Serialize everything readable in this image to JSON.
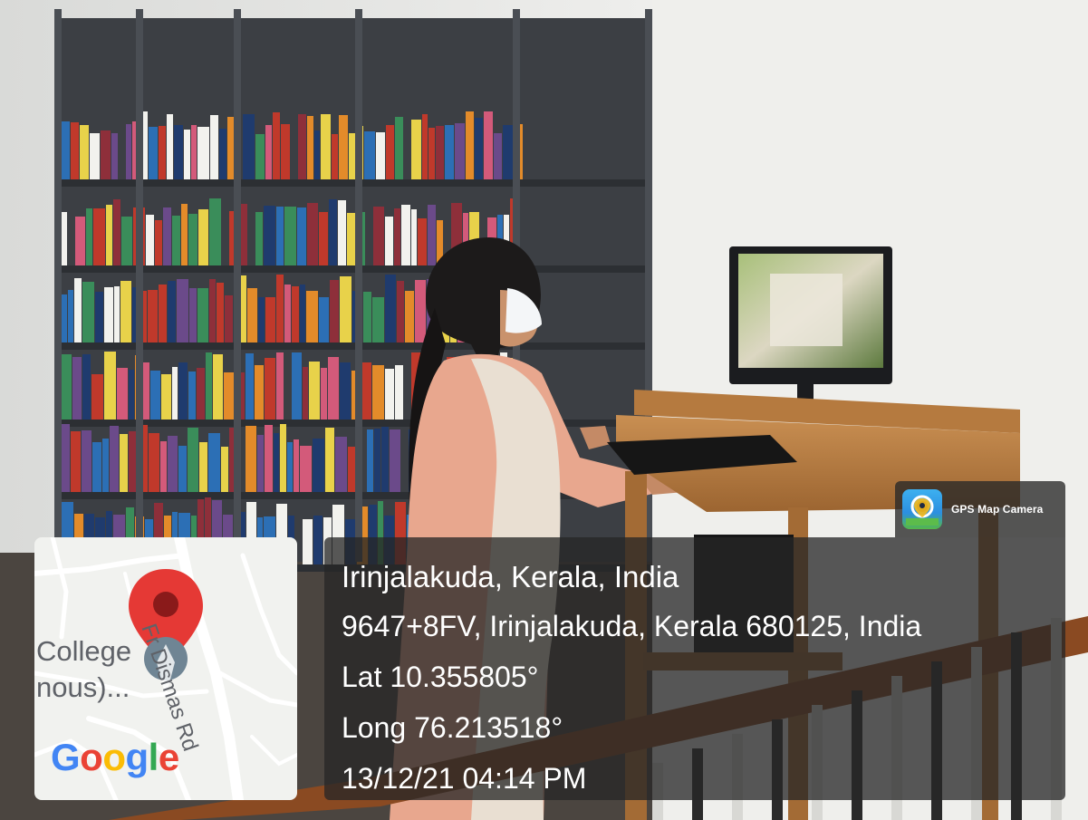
{
  "overlay": {
    "app_badge": {
      "label": "GPS Map Camera",
      "icon": "gps-map-camera-app-icon"
    },
    "location": {
      "title": "Irinjalakuda, Kerala, India",
      "address": "9647+8FV, Irinjalakuda, Kerala 680125, India",
      "lat": "Lat 10.355805°",
      "long": "Long 76.213518°",
      "datetime": "13/12/21 04:14 PM"
    },
    "map": {
      "place_lines": [
        "College",
        "nous)..."
      ],
      "road_label": "Fr Dismas Rd",
      "pin_icon": "location-pin-icon",
      "logo_letters": [
        {
          "char": "G",
          "color": "#4285F4"
        },
        {
          "char": "o",
          "color": "#EA4335"
        },
        {
          "char": "o",
          "color": "#FBBC05"
        },
        {
          "char": "g",
          "color": "#4285F4"
        },
        {
          "char": "l",
          "color": "#34A853"
        },
        {
          "char": "e",
          "color": "#EA4335"
        }
      ]
    }
  },
  "colors": {
    "pin": "#E53935",
    "panel": "#262626",
    "map_bg": "#F1F2EF"
  }
}
